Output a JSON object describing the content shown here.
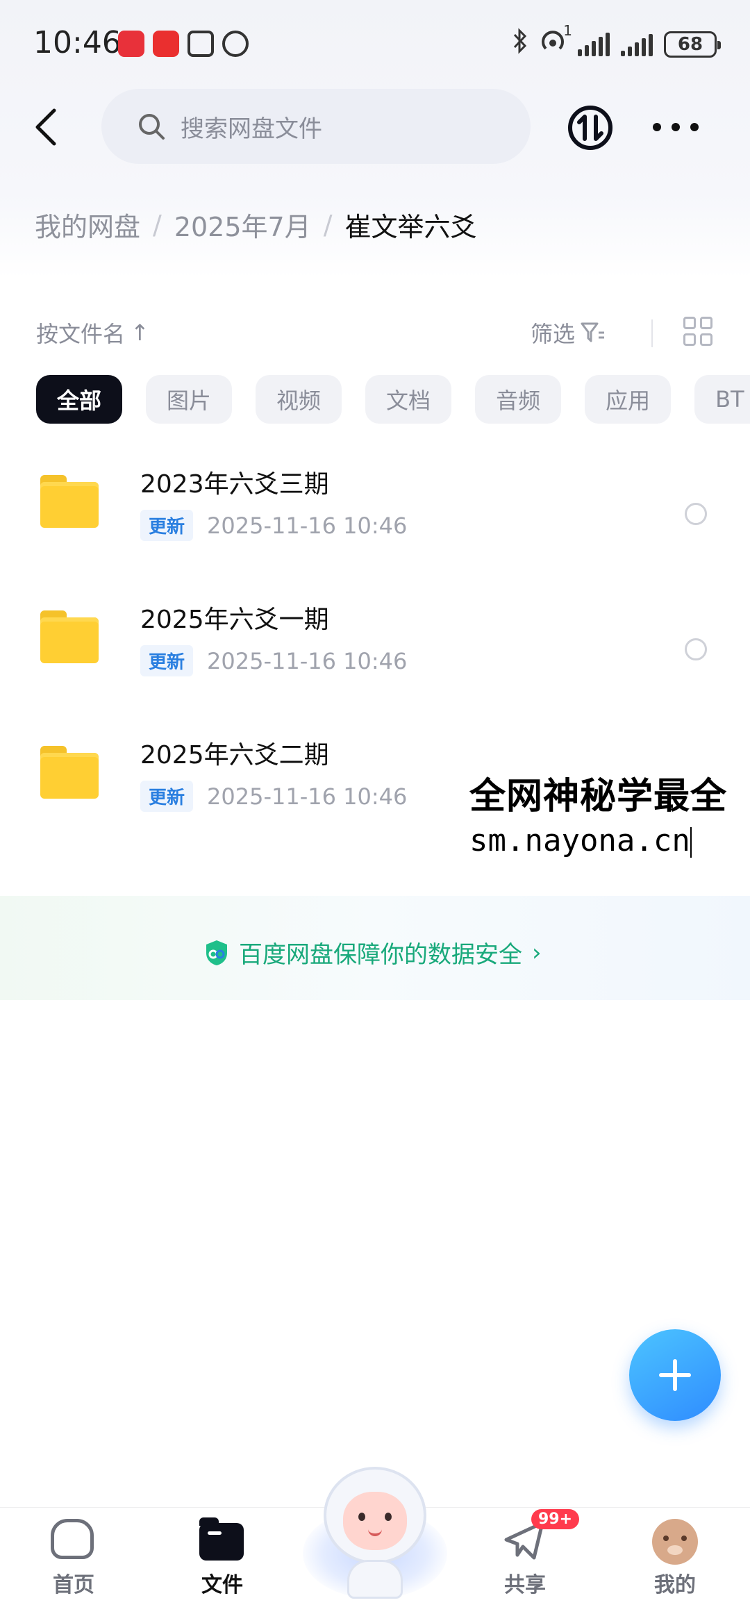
{
  "status_bar": {
    "time": "10:46",
    "battery": "68",
    "signal_sup": "1"
  },
  "header": {
    "search_placeholder": "搜索网盘文件"
  },
  "breadcrumb": {
    "items": [
      "我的网盘",
      "2025年7月"
    ],
    "current": "崔文举六爻"
  },
  "toolbar": {
    "sort_label": "按文件名",
    "sort_arrow": "↑",
    "filter_label": "筛选"
  },
  "chips": [
    "全部",
    "图片",
    "视频",
    "文档",
    "音频",
    "应用",
    "BT"
  ],
  "files": [
    {
      "name": "2023年六爻三期",
      "badge": "更新",
      "time": "2025-11-16  10:46"
    },
    {
      "name": "2025年六爻一期",
      "badge": "更新",
      "time": "2025-11-16  10:46"
    },
    {
      "name": "2025年六爻二期",
      "badge": "更新",
      "time": "2025-11-16  10:46"
    }
  ],
  "watermark": {
    "line1": "全网神秘学最全",
    "line2": "sm.nayona.cn"
  },
  "security_note": "百度网盘保障你的数据安全",
  "security_arrow": "›",
  "bottom_nav": {
    "home": "首页",
    "files": "文件",
    "share": "共享",
    "share_badge": "99+",
    "mine": "我的"
  },
  "colors": {
    "accent": "#2f8cff",
    "security": "#19a97b",
    "badge": "#ff3b4d",
    "folder": "#ffcf33"
  },
  "icons": [
    "back-icon",
    "search-icon",
    "sync-icon",
    "more-icon",
    "filter-icon",
    "grid-view-icon",
    "folder-icon",
    "shield-icon",
    "plus-icon",
    "home-icon",
    "files-icon",
    "share-icon",
    "avatar"
  ]
}
